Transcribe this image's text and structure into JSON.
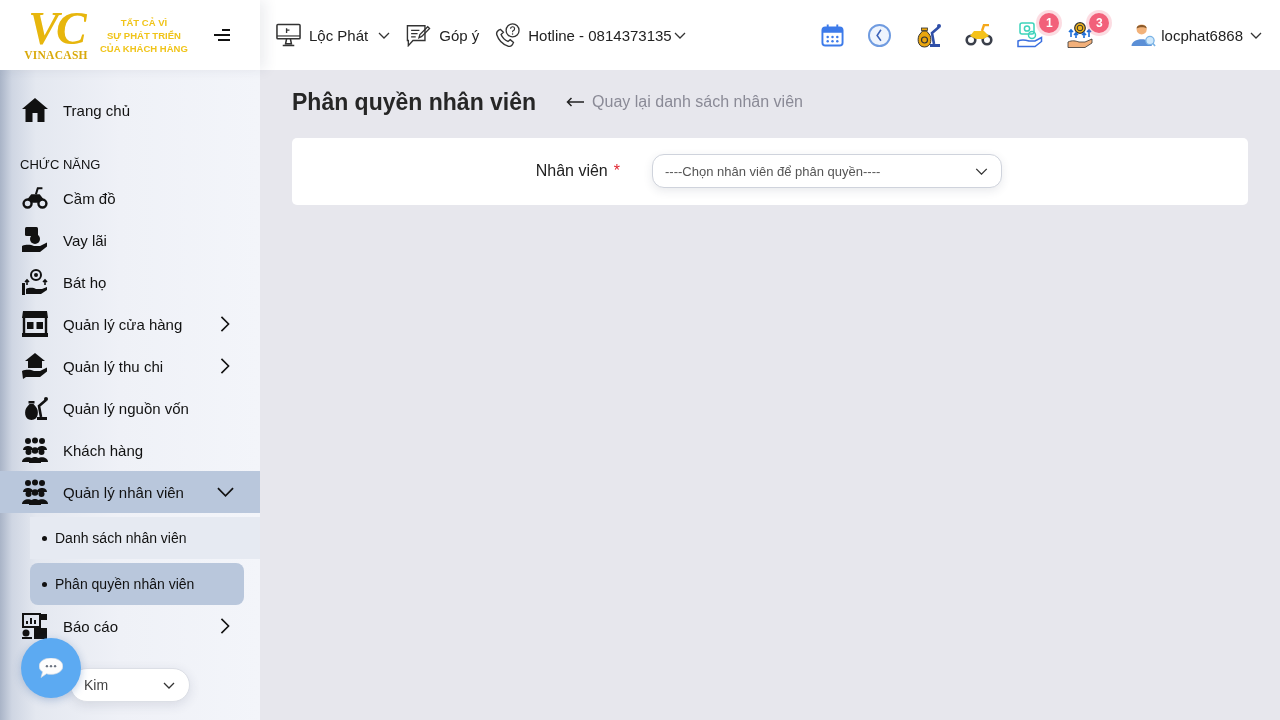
{
  "logo": {
    "monogram": "VC",
    "brand": "VINACASH",
    "tagline": [
      "TẤT CẢ VÌ",
      "SỰ PHÁT TRIỂN",
      "CỦA KHÁCH HÀNG"
    ]
  },
  "top_bar": {
    "store": {
      "label": "Lộc Phát"
    },
    "feedback": {
      "label": "Góp ý"
    },
    "hotline": {
      "label": "Hotline - 0814373135"
    },
    "header_icons": [
      {
        "kind": "calendar"
      },
      {
        "kind": "clock"
      },
      {
        "kind": "moneybag"
      },
      {
        "kind": "motorbike"
      },
      {
        "kind": "handmoney",
        "badge": "1"
      },
      {
        "kind": "coins",
        "badge": "3"
      }
    ],
    "user": {
      "name": "locphat6868"
    }
  },
  "sidebar": {
    "home": {
      "label": "Trang chủ",
      "selected": false
    },
    "section_heading": "CHỨC NĂNG",
    "items": [
      {
        "label": "Cầm đồ",
        "kind": "link",
        "selected": false
      },
      {
        "label": "Vay lãi",
        "kind": "link",
        "selected": false
      },
      {
        "label": "Bát họ",
        "kind": "link",
        "selected": false
      },
      {
        "label": "Quản lý cửa hàng",
        "kind": "group",
        "selected": false,
        "expanded": false
      },
      {
        "label": "Quản lý thu chi",
        "kind": "group",
        "selected": false,
        "expanded": false
      },
      {
        "label": "Quản lý nguồn vốn",
        "kind": "link",
        "selected": false
      },
      {
        "label": "Khách hàng",
        "kind": "link",
        "selected": false
      },
      {
        "label": "Quản lý nhân viên",
        "kind": "group",
        "selected": true,
        "expanded": true,
        "children": [
          {
            "label": "Danh sách nhân viên",
            "selected": false
          },
          {
            "label": "Phân quyền nhân viên",
            "selected": true
          }
        ]
      },
      {
        "label": "Báo cáo",
        "kind": "group",
        "selected": false,
        "expanded": false
      }
    ]
  },
  "floating_select": {
    "value": "Kim"
  },
  "page": {
    "title": "Phân quyền nhân viên",
    "back_link": "Quay lại danh sách nhân viên",
    "form": {
      "fields": [
        {
          "label": "Nhân viên",
          "required_mark": "*",
          "placeholder": "----Chọn nhân viên để phân quyền----"
        }
      ]
    }
  }
}
